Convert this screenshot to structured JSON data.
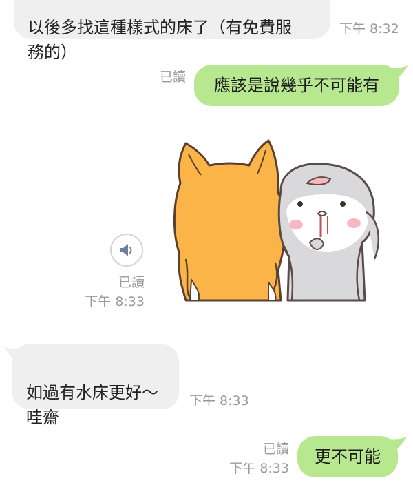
{
  "messages": [
    {
      "id": "m1",
      "direction": "incoming",
      "text": "以後多找這種樣式的床了（有免費服\n務的）",
      "time": "下午 8:32"
    },
    {
      "id": "m2",
      "direction": "outgoing",
      "text": "應該是說幾乎不可能有",
      "read": "已讀"
    },
    {
      "id": "m3",
      "direction": "outgoing",
      "type": "sticker",
      "sticker_icon": "shiba-and-rabbit-sticker",
      "read": "已讀",
      "time": "下午 8:33"
    },
    {
      "id": "m4",
      "direction": "incoming",
      "text": "如過有水床更好～\n哇齋",
      "time": "下午 8:33"
    },
    {
      "id": "m5",
      "direction": "outgoing",
      "text": "更不可能",
      "read": "已讀",
      "time": "下午 8:33"
    }
  ],
  "colors": {
    "incoming_bubble": "#efefef",
    "outgoing_bubble": "#b7e88f",
    "meta_text": "#9a9a9a"
  }
}
